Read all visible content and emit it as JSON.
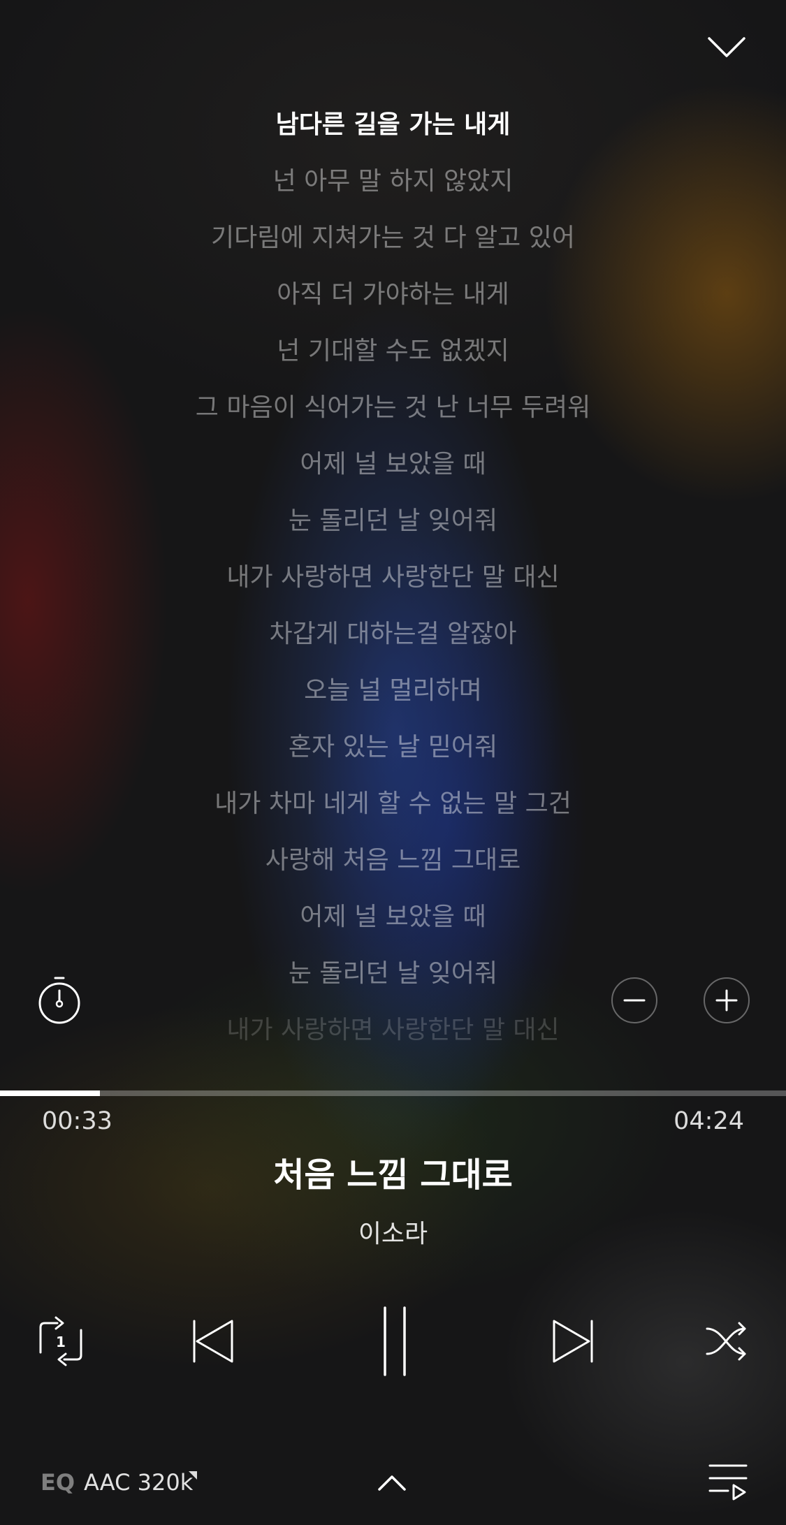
{
  "lyrics": {
    "current": "남다른 길을 가는 내게",
    "upcoming": [
      "넌 아무 말 하지 않았지",
      "기다림에 지쳐가는 것 다 알고 있어",
      "아직 더 가야하는 내게",
      "넌 기대할 수도 없겠지",
      "그 마음이 식어가는 것 난 너무 두려워",
      "어제 널 보았을 때",
      "눈 돌리던 날 잊어줘",
      "내가 사랑하면 사랑한단 말 대신",
      "차갑게 대하는걸 알잖아",
      "오늘 널 멀리하며",
      "혼자 있는 날 믿어줘",
      "내가 차마 네게 할 수 없는 말 그건",
      "사랑해 처음 느낌 그대로",
      "어제 널 보았을 때",
      "눈 돌리던 날 잊어줘"
    ],
    "faded": "내가 사랑하면 사랑한단 말 대신"
  },
  "playback": {
    "elapsed": "00:33",
    "total": "04:24",
    "progress_fraction": 0.127
  },
  "track": {
    "title": "처음 느낌 그대로",
    "artist": "이소라"
  },
  "controls": {
    "repeat_mode_badge": "1",
    "repeat_icon": "repeat-one-icon",
    "previous_icon": "skip-previous-icon",
    "pause_icon": "pause-icon",
    "next_icon": "skip-next-icon",
    "shuffle_icon": "shuffle-icon"
  },
  "footer": {
    "eq_label": "EQ",
    "quality": "AAC 320k"
  },
  "colors": {
    "accent": "#ffffff",
    "background": "#161617",
    "glow_blue": "#284696",
    "glow_orange": "#965f0f",
    "glow_red": "#781414"
  }
}
